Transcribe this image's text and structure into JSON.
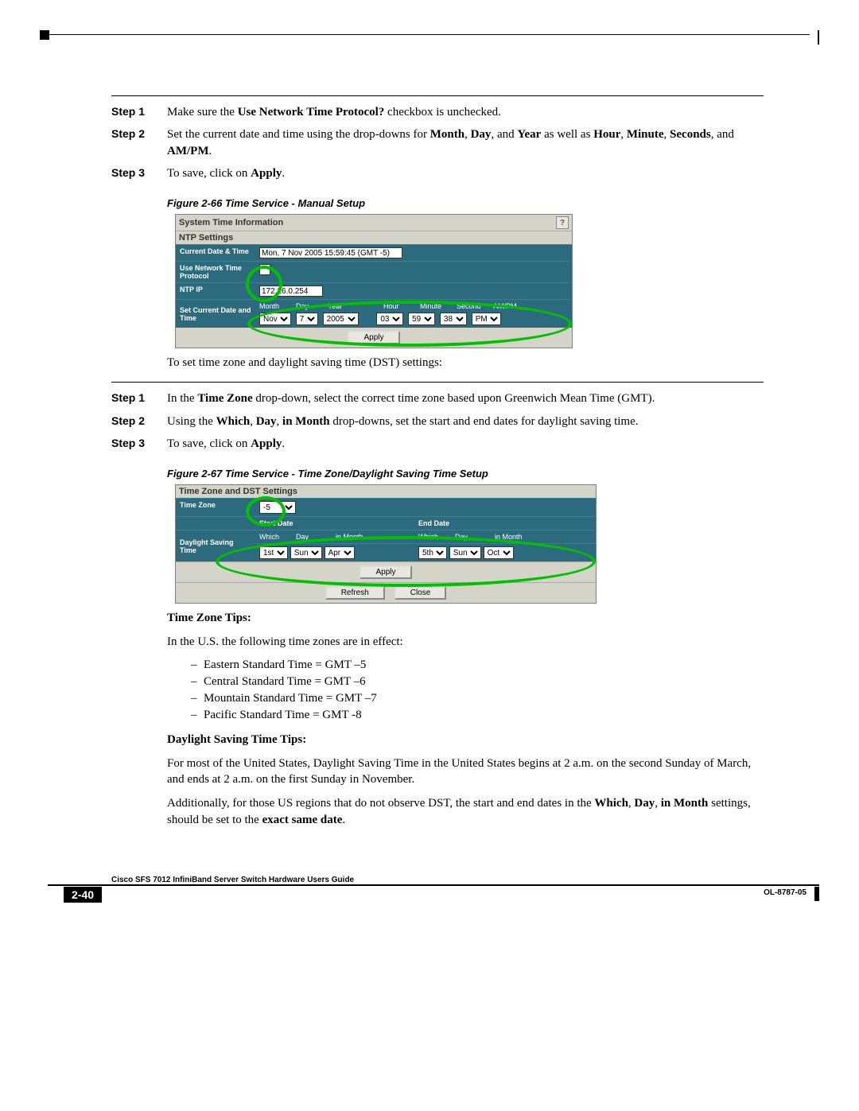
{
  "steps_a": [
    {
      "label": "Step 1",
      "text_parts": [
        "Make sure the ",
        "Use Network Time Protocol?",
        " checkbox is unchecked."
      ]
    },
    {
      "label": "Step 2",
      "text_parts": [
        "Set the current date and time using the drop-downs for ",
        "Month",
        ", ",
        "Day",
        ", and ",
        "Year",
        " as well as ",
        "Hour",
        ", ",
        "Minute",
        ", ",
        "Seconds",
        ", and ",
        "AM/PM",
        "."
      ]
    },
    {
      "label": "Step 3",
      "text_parts": [
        "To save, click on ",
        "Apply",
        "."
      ]
    }
  ],
  "fig1_caption": "Figure 2-66   Time Service - Manual Setup",
  "fig1": {
    "title": "System Time Information",
    "subtitle": "NTP Settings",
    "rows": {
      "cur_label": "Current Date & Time",
      "cur_value": "Mon, 7 Nov 2005 15:59:45 (GMT -5)",
      "ntp_proto_label": "Use Network Time Protocol",
      "ntp_ip_label": "NTP IP",
      "ntp_ip_value": "172.26.0.254",
      "set_label": "Set Current Date and Time",
      "headers": {
        "month": "Month",
        "day": "Day",
        "year": "Year",
        "hour": "Hour",
        "minute": "Minute",
        "second": "Second",
        "ampm": "AM/PM"
      },
      "values": {
        "month": "Nov",
        "day": "7",
        "year": "2005",
        "hour": "03",
        "minute": "59",
        "second": "38",
        "ampm": "PM"
      }
    },
    "apply": "Apply"
  },
  "between_text": "To set time zone and daylight saving time (DST) settings:",
  "steps_b": [
    {
      "label": "Step 1",
      "text_parts": [
        "In the ",
        "Time Zone",
        " drop-down, select the correct time zone based upon Greenwich Mean Time (GMT)."
      ]
    },
    {
      "label": "Step 2",
      "text_parts": [
        "Using the ",
        "Which",
        ", ",
        "Day",
        ", ",
        "in Month",
        " drop-downs, set the start and end dates for daylight saving time."
      ]
    },
    {
      "label": "Step 3",
      "text_parts": [
        "To save, click on ",
        "Apply",
        "."
      ]
    }
  ],
  "fig2_caption": "Figure 2-67   Time Service - Time Zone/Daylight Saving Time Setup",
  "fig2": {
    "title": "Time Zone and DST Settings",
    "tz_label": "Time Zone",
    "tz_value": "-5",
    "start_date": "Start Date",
    "end_date": "End Date",
    "dst_label": "Daylight Saving Time",
    "headers": {
      "which": "Which",
      "day": "Day",
      "inmonth": "in Month"
    },
    "start": {
      "which": "1st",
      "day": "Sun",
      "month": "Apr"
    },
    "end": {
      "which": "5th",
      "day": "Sun",
      "month": "Oct"
    },
    "apply": "Apply",
    "refresh": "Refresh",
    "close": "Close"
  },
  "tz_tips_head": "Time Zone Tips:",
  "tz_tips_intro": "In the U.S. the following time zones are in effect:",
  "tz_tips": [
    "Eastern Standard Time = GMT –5",
    "Central Standard Time = GMT –6",
    "Mountain Standard Time = GMT –7",
    "Pacific Standard Time = GMT -8"
  ],
  "dst_tips_head": "Daylight Saving Time Tips:",
  "dst_p1": "For most of the United States, Daylight Saving Time in the United States begins at 2 a.m. on the second Sunday of March, and ends at 2 a.m. on the first Sunday in November.",
  "dst_p2_parts": [
    "Additionally, for those US regions that do not observe DST, the start and end dates in the ",
    "Which",
    ", ",
    "Day",
    ", ",
    "in Month",
    " settings, should be set to the ",
    "exact same date",
    "."
  ],
  "footer": {
    "page": "2-40",
    "title": "Cisco SFS 7012 InfiniBand Server Switch Hardware Users Guide",
    "docid": "OL-8787-05"
  }
}
